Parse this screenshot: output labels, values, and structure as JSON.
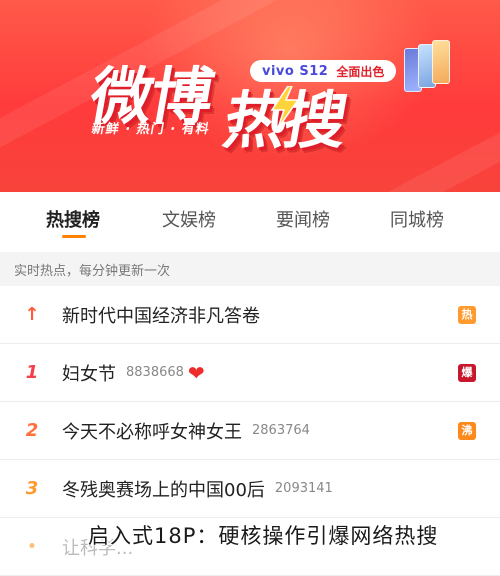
{
  "banner": {
    "title_part1": "微博",
    "title_part2": "热搜",
    "slogan": "新鲜 · 热门 · 有料",
    "ad_brand": "vivo S12",
    "ad_tag": "全面出色",
    "bg_color": "#ff3b3b"
  },
  "tabs": [
    {
      "label": "热搜榜",
      "active": true
    },
    {
      "label": "文娱榜",
      "active": false
    },
    {
      "label": "要闻榜",
      "active": false
    },
    {
      "label": "同城榜",
      "active": false
    }
  ],
  "subheader": "实时热点，每分钟更新一次",
  "list": [
    {
      "rank": "↑",
      "rank_type": "pinned",
      "title": "新时代中国经济非凡答卷",
      "count": "",
      "badge": "热",
      "badge_color": "#ff9a2e",
      "emoji": ""
    },
    {
      "rank": "1",
      "rank_type": "r1",
      "title": "妇女节",
      "count": "8838668",
      "badge": "爆",
      "badge_color": "#c8172c",
      "emoji": "❤"
    },
    {
      "rank": "2",
      "rank_type": "r2",
      "title": "今天不必称呼女神女王",
      "count": "2863764",
      "badge": "沸",
      "badge_color": "#ff8a1c",
      "emoji": ""
    },
    {
      "rank": "3",
      "rank_type": "r3",
      "title": "冬残奥赛场上的中国00后",
      "count": "2093141",
      "badge": "",
      "badge_color": "",
      "emoji": ""
    },
    {
      "rank": "•",
      "rank_type": "r4",
      "title": "让科学...",
      "count": "",
      "badge": "",
      "badge_color": "",
      "emoji": ""
    }
  ],
  "caption": "启入式18P：硬核操作引爆网络热搜",
  "colors": {
    "accent": "#ff8200",
    "brand_red": "#e0232d"
  }
}
